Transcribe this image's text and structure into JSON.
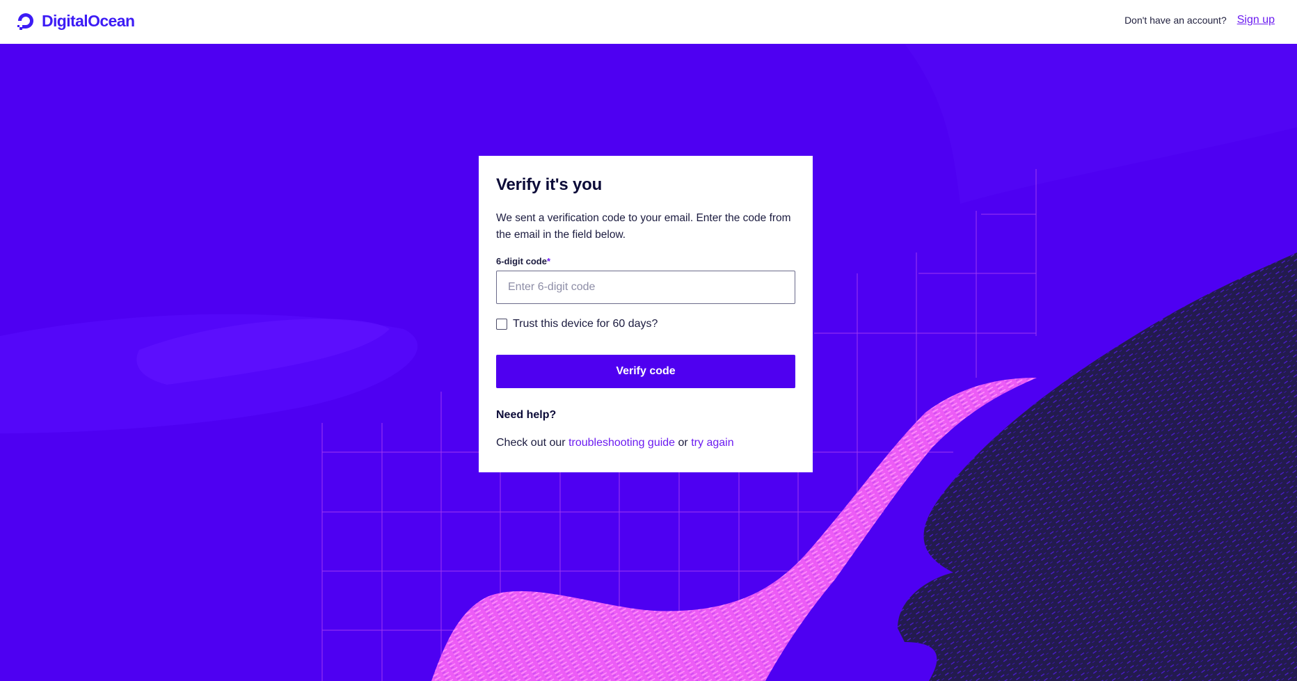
{
  "brand": {
    "name": "DigitalOcean",
    "logo_icon": "digitalocean-logo-icon",
    "color": "#3d1cf5"
  },
  "header": {
    "no_account_text": "Don't have an account?",
    "signup_label": "Sign up"
  },
  "card": {
    "title": "Verify it's you",
    "description": "We sent a verification code to your email. Enter the code from the email in the field below.",
    "code_label": "6-digit code",
    "required_marker": "*",
    "code_placeholder": "Enter 6-digit code",
    "code_value": "",
    "trust_label": "Trust this device for 60 days?",
    "trust_checked": false,
    "verify_button": "Verify code",
    "help_title": "Need help?",
    "help_prefix": "Check out our",
    "help_link_guide": "troubleshooting guide",
    "help_or": "or",
    "help_link_retry": "try again"
  },
  "colors": {
    "background": "#4e00f2",
    "accent": "#6b1bf0",
    "button": "#4f00f0",
    "dark_wave": "#241c4f",
    "pink_brush": "#f56cf7"
  }
}
